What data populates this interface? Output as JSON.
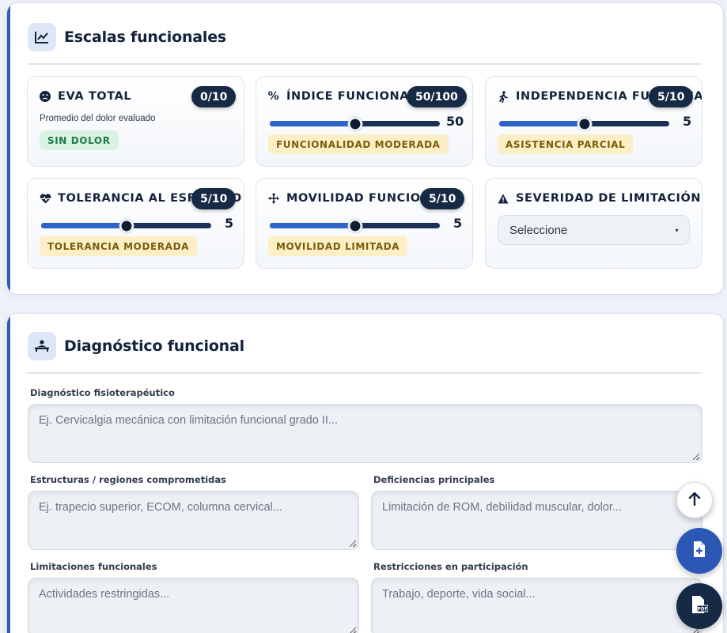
{
  "scales": {
    "title": "Escalas funcionales",
    "cards": [
      {
        "title": "EVA TOTAL",
        "badge": "0/10",
        "subtitle": "Promedio del dolor evaluado",
        "tag": "SIN DOLOR"
      },
      {
        "title": "ÍNDICE FUNCIONAL",
        "badge": "50/100",
        "value": 50,
        "max": 100,
        "value_label": "50",
        "tag": "FUNCIONALIDAD MODERADA"
      },
      {
        "title": "INDEPENDENCIA FUNCIONAL",
        "badge": "5/10",
        "value": 5,
        "max": 10,
        "value_label": "5",
        "tag": "ASISTENCIA PARCIAL"
      },
      {
        "title": "TOLERANCIA AL ESFUERZO",
        "badge": "5/10",
        "value": 5,
        "max": 10,
        "value_label": "5",
        "tag": "TOLERANCIA MODERADA"
      },
      {
        "title": "MOVILIDAD FUNCIONAL",
        "badge": "5/10",
        "value": 5,
        "max": 10,
        "value_label": "5",
        "tag": "MOVILIDAD LIMITADA"
      },
      {
        "title": "SEVERIDAD DE LIMITACIÓN",
        "select_value": "Seleccione"
      }
    ]
  },
  "diagnosis": {
    "title": "Diagnóstico funcional",
    "fields": [
      {
        "label": "Diagnóstico fisioterapéutico",
        "placeholder": "Ej. Cervicalgia mecánica con limitación funcional grado II..."
      },
      {
        "label": "Estructuras / regiones comprometidas",
        "placeholder": "Ej. trapecio superior, ECOM, columna cervical..."
      },
      {
        "label": "Deficiencias principales",
        "placeholder": "Limitación de ROM, debilidad muscular, dolor..."
      },
      {
        "label": "Limitaciones funcionales",
        "placeholder": "Actividades restringidas..."
      },
      {
        "label": "Restricciones en participación",
        "placeholder": "Trabajo, deporte, vida social..."
      }
    ]
  },
  "fabs": {
    "scroll_top_icon": "arrow-up-icon",
    "add_doc_icon": "file-plus-icon",
    "pdf_icon": "pdf-file-icon"
  },
  "colors": {
    "accent": "#2d5bb8",
    "badge": "#172a45",
    "tag_warning_bg": "#fcefc6",
    "tag_success_bg": "#d9f2e3"
  }
}
